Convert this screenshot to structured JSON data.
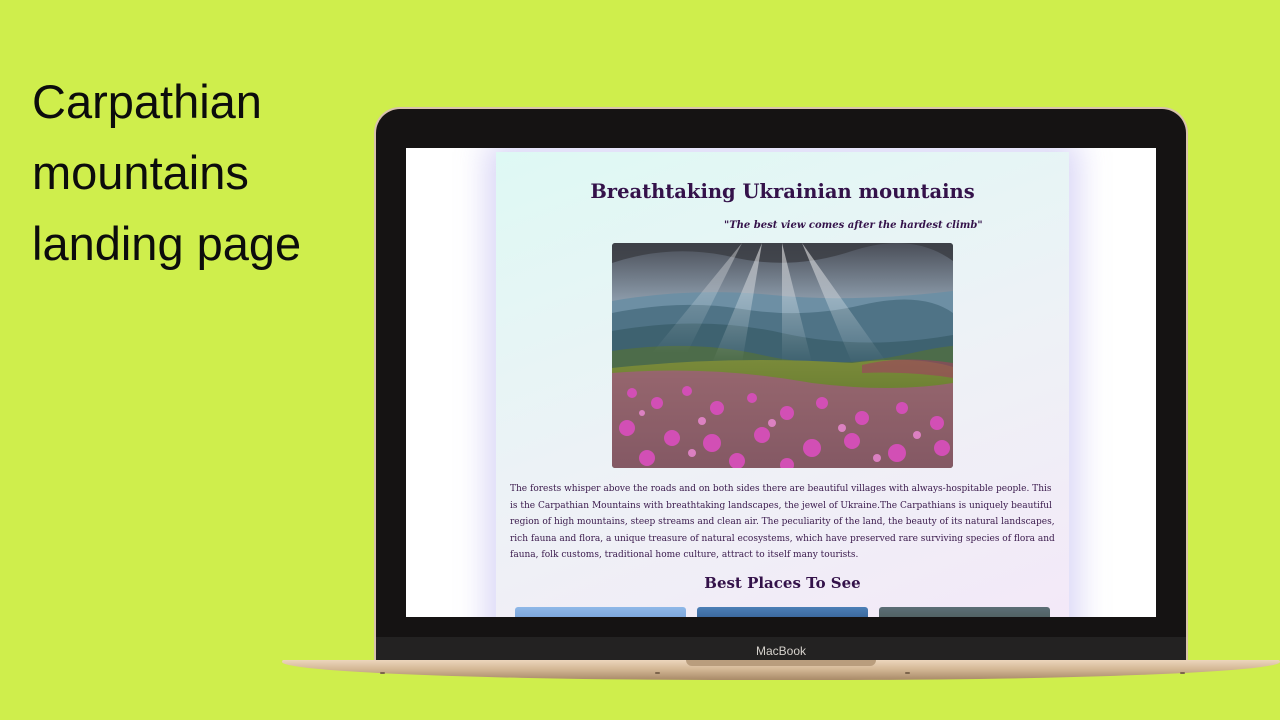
{
  "promo": {
    "title_lines": [
      "Carpathian",
      "mountains",
      "landing page"
    ]
  },
  "device": {
    "brand_label": "MacBook"
  },
  "page": {
    "title": "Breathtaking Ukrainian mountains",
    "quote": "\"The best view comes after the hardest climb\"",
    "hero_image": "carpathian-mountain-rhododendron-meadow-photo",
    "description": "The forests whisper above the roads and on both sides there are beautiful villages with always-hospitable people. This is the Carpathian Mountains with breathtaking landscapes, the jewel of Ukraine.The Carpathians is uniquely beautiful region of high mountains, steep streams and clean air. The peculiarity of the land, the beauty of its natural landscapes, rich fauna and flora, a unique treasure of natural ecosystems, which have preserved rare surviving species of flora and fauna, folk customs, traditional home culture, attract to itself many tourists.",
    "section_title": "Best Places To See",
    "place_thumbnails": [
      "place-photo-1",
      "place-photo-2",
      "place-photo-3"
    ]
  },
  "colors": {
    "background": "#cfee4c",
    "heading": "#34124a",
    "card_glow": "#968ce6"
  }
}
